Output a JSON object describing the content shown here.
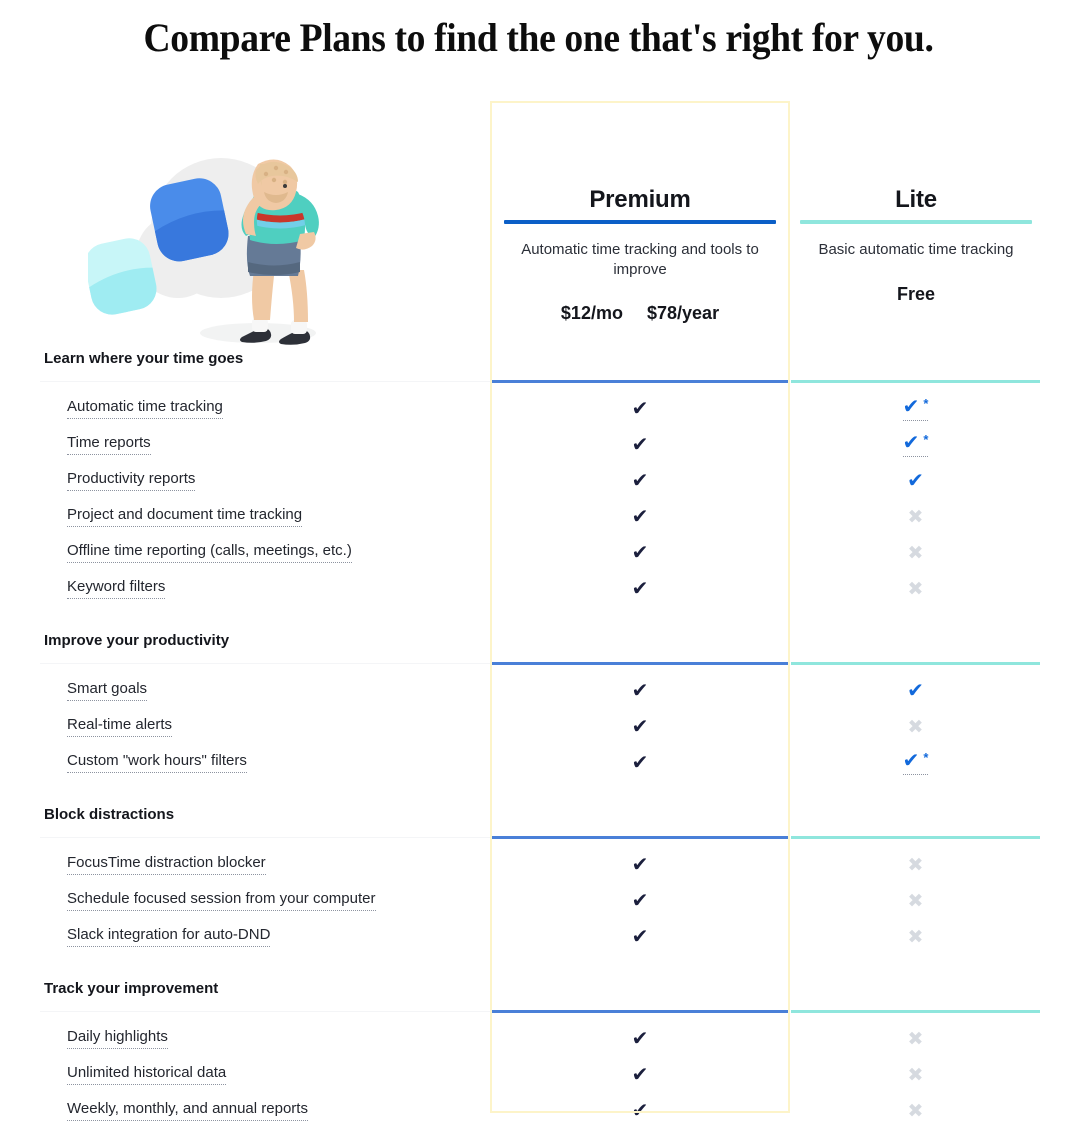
{
  "page": {
    "title": "Compare Plans to find the one that's right for you."
  },
  "colors": {
    "premium_accent": "#0b5fc7",
    "lite_accent": "#8fe6dd",
    "premium_divider": "#4a80d8",
    "check_dark": "#1b1f3d",
    "check_blue": "#1269db",
    "cross_gray": "#d6dae0",
    "highlight_border": "#fdf4c9"
  },
  "illustration": {
    "name": "person-thinking-illustration",
    "alt": "Person with hand on head thinking next to rounded squares"
  },
  "plans": [
    {
      "id": "premium",
      "name": "Premium",
      "description": "Automatic time tracking and tools to improve",
      "price_monthly": "$12/mo",
      "price_yearly": "$78/year",
      "highlighted": true
    },
    {
      "id": "lite",
      "name": "Lite",
      "description": "Basic automatic time tracking",
      "price": "Free",
      "highlighted": false
    }
  ],
  "sections": [
    {
      "title": "Learn where your time goes",
      "features": [
        {
          "label": "Automatic time tracking",
          "premium": "check",
          "lite": "check-note"
        },
        {
          "label": "Time reports",
          "premium": "check",
          "lite": "check-note"
        },
        {
          "label": "Productivity reports",
          "premium": "check",
          "lite": "check"
        },
        {
          "label": "Project and document time tracking",
          "premium": "check",
          "lite": "cross"
        },
        {
          "label": "Offline time reporting (calls, meetings, etc.)",
          "premium": "check",
          "lite": "cross"
        },
        {
          "label": "Keyword filters",
          "premium": "check",
          "lite": "cross"
        }
      ]
    },
    {
      "title": "Improve your productivity",
      "features": [
        {
          "label": "Smart goals",
          "premium": "check",
          "lite": "check"
        },
        {
          "label": "Real-time alerts",
          "premium": "check",
          "lite": "cross"
        },
        {
          "label": "Custom \"work hours\" filters",
          "premium": "check",
          "lite": "check-note"
        }
      ]
    },
    {
      "title": "Block distractions",
      "features": [
        {
          "label": "FocusTime distraction blocker",
          "premium": "check",
          "lite": "cross"
        },
        {
          "label": "Schedule focused session from your computer",
          "premium": "check",
          "lite": "cross"
        },
        {
          "label": "Slack integration for auto-DND",
          "premium": "check",
          "lite": "cross"
        }
      ]
    },
    {
      "title": "Track your improvement",
      "features": [
        {
          "label": "Daily highlights",
          "premium": "check",
          "lite": "cross"
        },
        {
          "label": "Unlimited historical data",
          "premium": "check",
          "lite": "cross"
        },
        {
          "label": "Weekly, monthly, and annual reports",
          "premium": "check",
          "lite": "cross"
        }
      ]
    }
  ],
  "glyphs": {
    "check": "✔",
    "cross": "✖",
    "asterisk": "*"
  }
}
